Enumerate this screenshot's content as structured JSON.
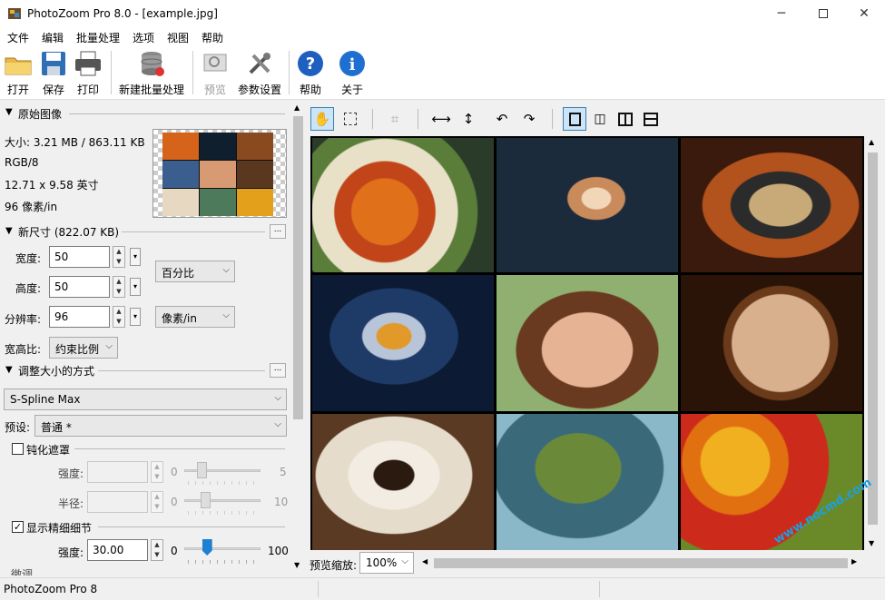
{
  "window": {
    "title": "PhotoZoom Pro 8.0 - [example.jpg]"
  },
  "menu": [
    "文件",
    "编辑",
    "批量处理",
    "选项",
    "视图",
    "帮助"
  ],
  "toolbar": {
    "open": "打开",
    "save": "保存",
    "print": "打印",
    "new_batch": "新建批量处理",
    "preview": "预览",
    "settings": "参数设置",
    "help": "帮助",
    "about": "关于"
  },
  "original": {
    "header": "原始图像",
    "size": "大小: 3.21 MB / 863.11 KB",
    "mode": "RGB/8",
    "dimensions": "12.71 x 9.58 英寸",
    "resolution": "96 像素/in"
  },
  "new_size": {
    "header": "新尺寸 (822.07 KB)",
    "width_label": "宽度:",
    "width_value": "50",
    "height_label": "高度:",
    "height_value": "50",
    "res_label": "分辨率:",
    "res_value": "96",
    "unit_size": "百分比",
    "unit_res": "像素/in",
    "aspect_label": "宽高比:",
    "aspect_value": "约束比例"
  },
  "resize": {
    "header": "调整大小的方式",
    "method": "S-Spline Max",
    "preset_label": "预设:",
    "preset_value": "普通 *"
  },
  "unsharp": {
    "label": "钝化遮罩",
    "checked": false,
    "strength_label": "强度:",
    "strength_min": "0",
    "strength_max": "5",
    "radius_label": "半径:",
    "radius_min": "0",
    "radius_max": "10"
  },
  "fine_detail": {
    "label": "显示精细细节",
    "checked": true,
    "strength_label": "强度:",
    "strength_value": "30.00",
    "min": "0",
    "max": "100",
    "level": 0.3
  },
  "cut_label": "微调",
  "preview": {
    "zoom_label": "预览缩放:",
    "zoom_value": "100%"
  },
  "status": {
    "text": "PhotoZoom Pro 8"
  },
  "watermark": "www.nocmd.com",
  "colors": {
    "accent": "#1f7fd0",
    "window_bg": "#f0f0f0"
  }
}
